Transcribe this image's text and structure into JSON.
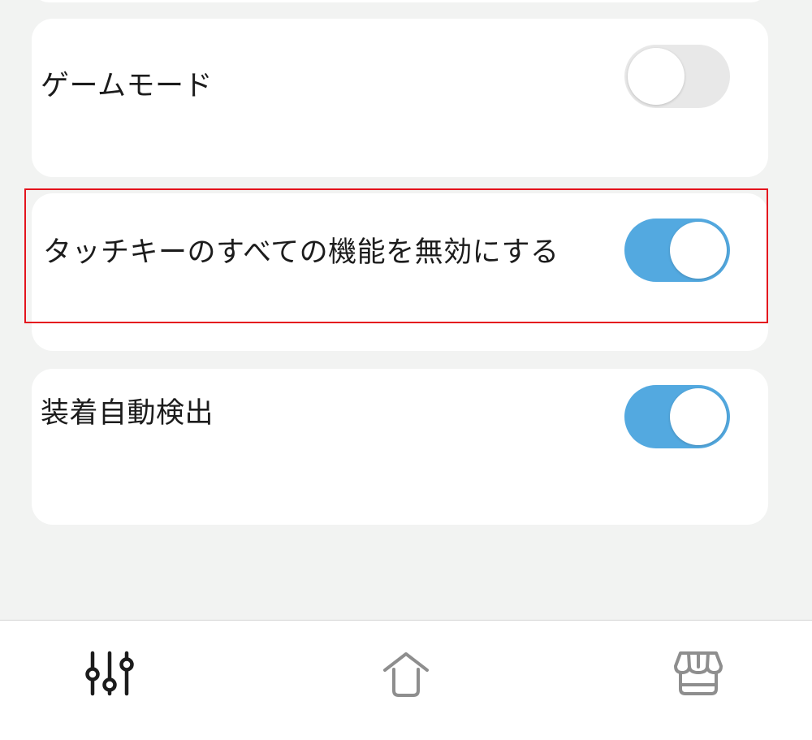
{
  "settings": {
    "items": [
      {
        "label": "ゲームモード",
        "enabled": false
      },
      {
        "label": "タッチキーのすべての機能を無効にする",
        "enabled": true
      },
      {
        "label": "装着自動検出",
        "enabled": true
      }
    ]
  },
  "highlight": {
    "color": "#e4141e",
    "target": "タッチキーのすべての機能を無効にする"
  },
  "colors": {
    "background": "#f2f3f2",
    "card": "#ffffff",
    "toggle_on": "#53a9e0",
    "toggle_off": "#e8e8e8"
  },
  "bottom_nav": {
    "items": [
      {
        "icon": "sliders-icon",
        "active": true
      },
      {
        "icon": "home-icon",
        "active": false
      },
      {
        "icon": "store-icon",
        "active": false
      }
    ]
  }
}
